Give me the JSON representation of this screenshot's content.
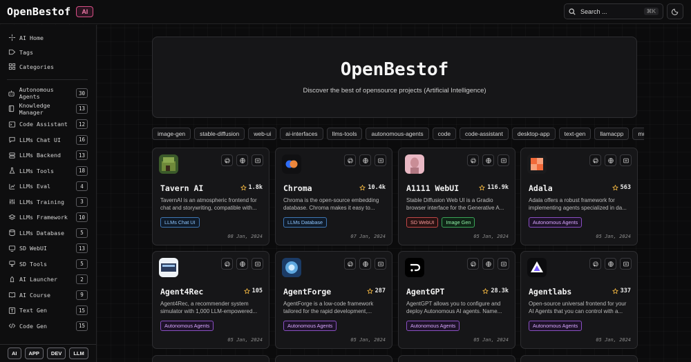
{
  "header": {
    "logo": "OpenBestof",
    "logo_badge": "AI",
    "search_label": "Search ...",
    "search_kbd": "⌘K"
  },
  "sidebar": {
    "nav": [
      {
        "label": "AI Home",
        "icon": "sparkles-icon"
      },
      {
        "label": "Tags",
        "icon": "tag-icon"
      },
      {
        "label": "Categories",
        "icon": "grid-icon"
      }
    ],
    "categories": [
      {
        "label": "Autonomous Agents",
        "count": "30",
        "icon": "bot-icon"
      },
      {
        "label": "Knowledge Manager",
        "count": "13",
        "icon": "book-icon"
      },
      {
        "label": "Code Assistant",
        "count": "12",
        "icon": "terminal-icon"
      },
      {
        "label": "LLMs Chat UI",
        "count": "16",
        "icon": "chat-icon"
      },
      {
        "label": "LLMs Backend",
        "count": "13",
        "icon": "server-icon"
      },
      {
        "label": "LLMs Tools",
        "count": "18",
        "icon": "flask-icon"
      },
      {
        "label": "LLMs Eval",
        "count": "4",
        "icon": "chart-icon"
      },
      {
        "label": "LLMs Training",
        "count": "3",
        "icon": "sliders-icon"
      },
      {
        "label": "LLMs Framework",
        "count": "10",
        "icon": "layers-icon"
      },
      {
        "label": "LLMs Database",
        "count": "5",
        "icon": "database-icon"
      },
      {
        "label": "SD WebUI",
        "count": "13",
        "icon": "monitor-icon"
      },
      {
        "label": "SD Tools",
        "count": "5",
        "icon": "brush-icon"
      },
      {
        "label": "AI Launcher",
        "count": "2",
        "icon": "rocket-icon"
      },
      {
        "label": "AI Course",
        "count": "9",
        "icon": "book-open-icon"
      },
      {
        "label": "Text Gen",
        "count": "15",
        "icon": "text-icon"
      },
      {
        "label": "Code Gen",
        "count": "15",
        "icon": "code-icon"
      }
    ],
    "bottom_buttons": [
      "AI",
      "APP",
      "DEV",
      "LLM"
    ]
  },
  "hero": {
    "title": "OpenBestof",
    "subtitle": "Discover the best of opensource projects (Artificial Intelligence)"
  },
  "tags": [
    "image-gen",
    "stable-diffusion",
    "web-ui",
    "ai-interfaces",
    "llms-tools",
    "autonomous-agents",
    "code",
    "code-assistant",
    "desktop-app",
    "text-gen",
    "llamacpp",
    "multi-"
  ],
  "cards": [
    {
      "name": "Tavern AI",
      "stars": "1.8k",
      "desc1": "TavernAI is an atmospheric frontend for",
      "desc2": "chat and storywriting, compatible with...",
      "badges": [
        {
          "label": "LLMs Chat UI",
          "color": "blue"
        }
      ],
      "date": "08 Jan, 2024",
      "logo": "tavern"
    },
    {
      "name": "Chroma",
      "stars": "10.4k",
      "desc1": "Chroma is the open-source embedding",
      "desc2": "database. Chroma makes it easy to...",
      "badges": [
        {
          "label": "LLMs Database",
          "color": "blue"
        }
      ],
      "date": "07 Jan, 2024",
      "logo": "chroma"
    },
    {
      "name": "A1111 WebUI",
      "stars": "116.9k",
      "desc1": "Stable Diffusion Web UI is a Gradio",
      "desc2": "browser interface for the Generative A...",
      "badges": [
        {
          "label": "SD WebUI",
          "color": "red"
        },
        {
          "label": "Image Gen",
          "color": "green"
        }
      ],
      "date": "05 Jan, 2024",
      "logo": "a1111"
    },
    {
      "name": "Adala",
      "stars": "563",
      "desc1": "Adala offers a robust framework for",
      "desc2": "implementing agents specialized in da...",
      "badges": [
        {
          "label": "Autonomous Agents",
          "color": "purple"
        }
      ],
      "date": "05 Jan, 2024",
      "logo": "adala"
    },
    {
      "name": "Agent4Rec",
      "stars": "105",
      "desc1": "Agent4Rec, a recommender system",
      "desc2": "simulator with 1,000 LLM-empowered...",
      "badges": [
        {
          "label": "Autonomous Agents",
          "color": "purple"
        }
      ],
      "date": "05 Jan, 2024",
      "logo": "agent4rec"
    },
    {
      "name": "AgentForge",
      "stars": "287",
      "desc1": "AgentForge is a low-code framework",
      "desc2": "tailored for the rapid development,...",
      "badges": [
        {
          "label": "Autonomous Agents",
          "color": "purple"
        }
      ],
      "date": "05 Jan, 2024",
      "logo": "agentforge"
    },
    {
      "name": "AgentGPT",
      "stars": "28.3k",
      "desc1": "AgentGPT allows you to configure and",
      "desc2": "deploy Autonomous AI agents. Name...",
      "badges": [
        {
          "label": "Autonomous Agents",
          "color": "purple"
        }
      ],
      "date": "05 Jan, 2024",
      "logo": "agentgpt"
    },
    {
      "name": "Agentlabs",
      "stars": "337",
      "desc1": "Open-source universal frontend for your",
      "desc2": "AI Agents that you can control with a...",
      "badges": [
        {
          "label": "Autonomous Agents",
          "color": "purple"
        }
      ],
      "date": "05 Jan, 2024",
      "logo": "agentlabs"
    }
  ],
  "colors": {
    "accent_pink": "#d94f86",
    "star": "#f5b942",
    "background": "#0b0b0c"
  }
}
